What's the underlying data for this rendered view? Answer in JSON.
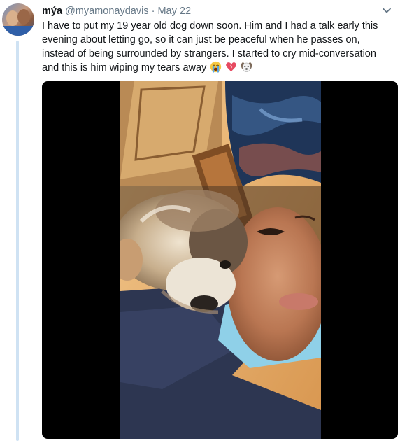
{
  "tweet": {
    "display_name": "mýa",
    "handle": "@myamonaydavis",
    "separator": "·",
    "date": "May 22",
    "text": "I have to put my 19 year old dog down soon. Him and I had a talk early this evening about letting go, so it can just be peaceful when he passes on, instead of being surrounded by strangers. I started to cry mid-conversation and this is him wiping my tears away",
    "emojis": [
      "loudly-crying-face-icon",
      "broken-heart-icon",
      "dog-face-icon"
    ]
  },
  "colors": {
    "text": "#14171a",
    "muted": "#657786",
    "thread_line": "#cfe2f3",
    "media_background": "#000000"
  },
  "icons": {
    "menu": "chevron-down-icon",
    "avatar": "profile-photo"
  },
  "media": {
    "type": "video",
    "subject": "video frame"
  }
}
